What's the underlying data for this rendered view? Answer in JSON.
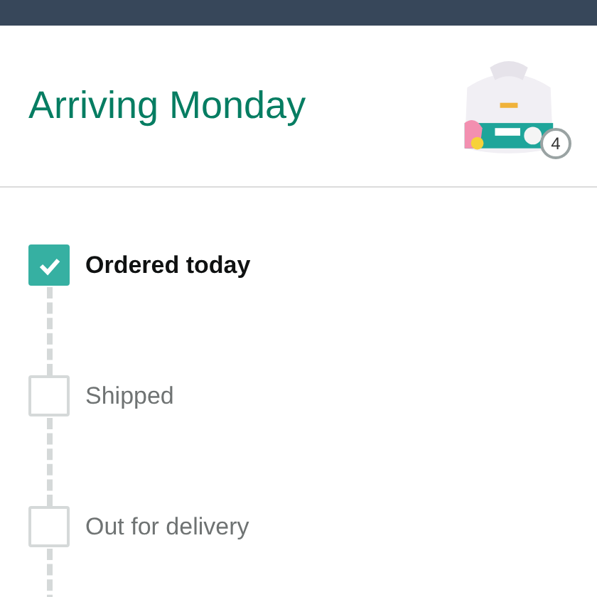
{
  "header": {
    "title": "Arriving Monday",
    "product": {
      "kind": "picture",
      "quantity": "4"
    }
  },
  "steps": [
    {
      "label": "Ordered today",
      "checked": true
    },
    {
      "label": "Shipped",
      "checked": false
    },
    {
      "label": "Out for delivery",
      "checked": false
    }
  ]
}
